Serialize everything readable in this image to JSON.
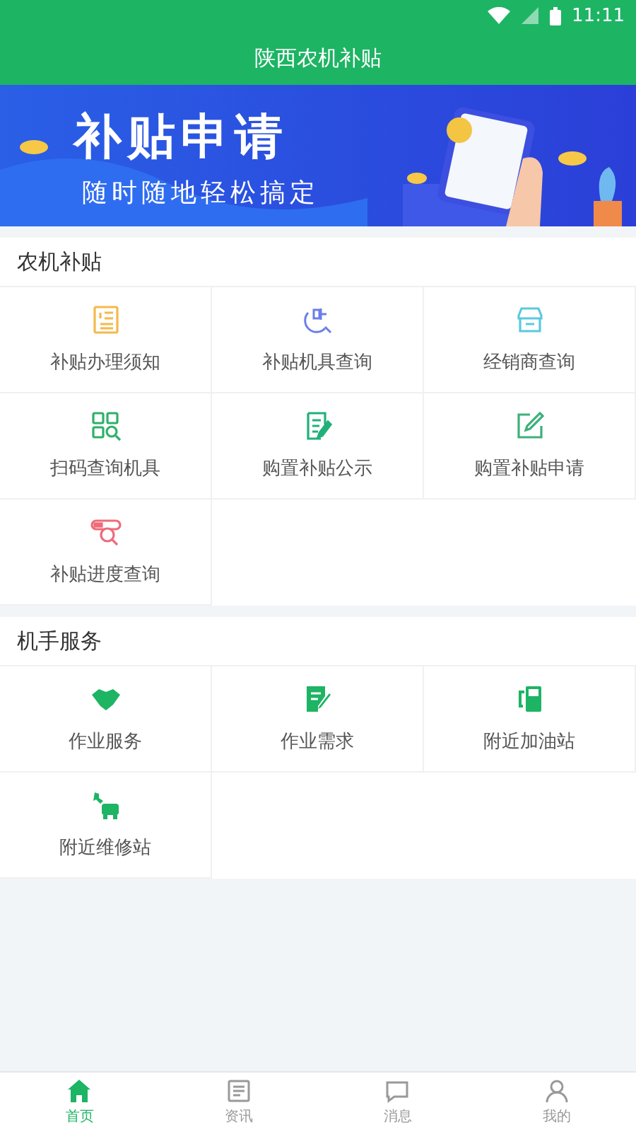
{
  "status_bar": {
    "time": "11:11"
  },
  "header": {
    "title": "陕西农机补贴"
  },
  "banner": {
    "title": "补贴申请",
    "subtitle": "随时随地轻松搞定"
  },
  "sections": [
    {
      "title": "农机补贴",
      "items": [
        {
          "label": "补贴办理须知",
          "color": "#f5b94a"
        },
        {
          "label": "补贴机具查询",
          "color": "#6b7ee8"
        },
        {
          "label": "经销商查询",
          "color": "#5cc8e0"
        },
        {
          "label": "扫码查询机具",
          "color": "#2fb06a"
        },
        {
          "label": "购置补贴公示",
          "color": "#22b07a"
        },
        {
          "label": "购置补贴申请",
          "color": "#3fb07a"
        },
        {
          "label": "补贴进度查询",
          "color": "#ee6b7a"
        }
      ]
    },
    {
      "title": "机手服务",
      "items": [
        {
          "label": "作业服务",
          "color": "#1db464"
        },
        {
          "label": "作业需求",
          "color": "#1db464"
        },
        {
          "label": "附近加油站",
          "color": "#1db464"
        },
        {
          "label": "附近维修站",
          "color": "#1db464"
        }
      ]
    }
  ],
  "tabs": [
    {
      "label": "首页",
      "selected": true
    },
    {
      "label": "资讯",
      "selected": false
    },
    {
      "label": "消息",
      "selected": false
    },
    {
      "label": "我的",
      "selected": false
    }
  ]
}
